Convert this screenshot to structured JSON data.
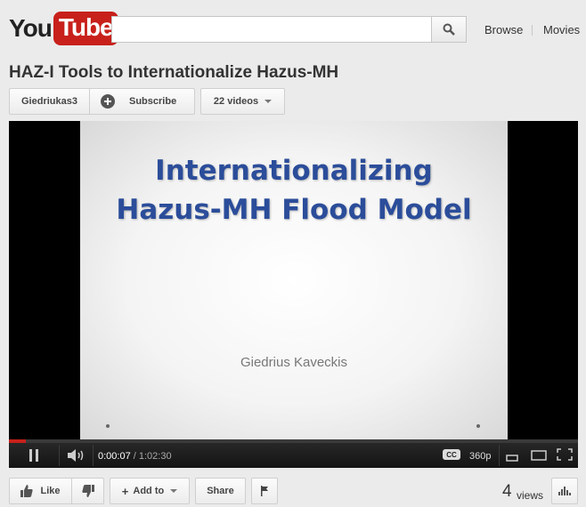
{
  "header": {
    "logo_you": "You",
    "logo_tube": "Tube",
    "search_placeholder": "",
    "nav": [
      "Browse",
      "Movies"
    ]
  },
  "video": {
    "title": "HAZ-I Tools to Internationalize Hazus-MH",
    "channel": "Giedriukas3",
    "subscribe_label": "Subscribe",
    "videos_label": "22 videos",
    "slide_title": "Internationalizing Hazus-MH Flood Model",
    "slide_author": "Giedrius Kaveckis",
    "player": {
      "current_time": "0:00:07",
      "separator": " / ",
      "duration": "1:02:30",
      "quality": "360p",
      "cc_label": "CC",
      "progress": 0.03
    }
  },
  "actions": {
    "like_label": "Like",
    "add_to_label": "Add to",
    "share_label": "Share",
    "views_count": "4",
    "views_label": "views"
  },
  "colors": {
    "accent": "#c8201b",
    "slide_text": "#2b4d9a"
  }
}
